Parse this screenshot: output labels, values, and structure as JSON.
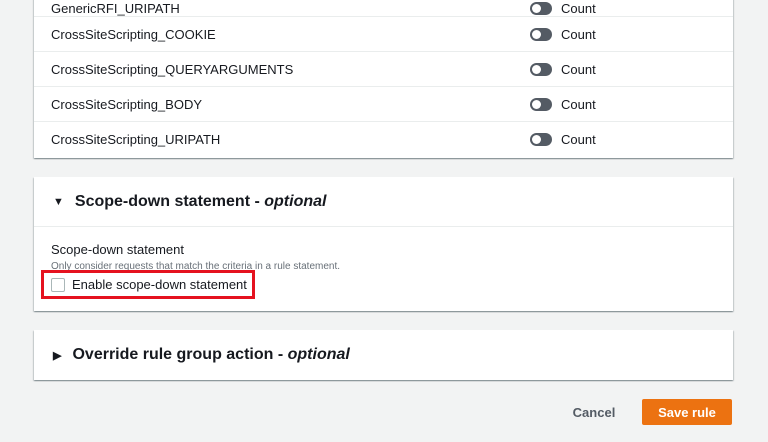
{
  "rules": [
    {
      "name": "GenericRFI_URIPATH",
      "action": "Count"
    },
    {
      "name": "CrossSiteScripting_COOKIE",
      "action": "Count"
    },
    {
      "name": "CrossSiteScripting_QUERYARGUMENTS",
      "action": "Count"
    },
    {
      "name": "CrossSiteScripting_BODY",
      "action": "Count"
    },
    {
      "name": "CrossSiteScripting_URIPATH",
      "action": "Count"
    }
  ],
  "scope": {
    "title": "Scope-down statement",
    "optional": "optional",
    "label": "Scope-down statement",
    "description": "Only consider requests that match the criteria in a rule statement.",
    "checkbox_label": "Enable scope-down statement",
    "checked": false
  },
  "override": {
    "title": "Override rule group action",
    "optional": "optional"
  },
  "actions": {
    "cancel": "Cancel",
    "save": "Save rule"
  },
  "colors": {
    "primary": "#ec7211",
    "highlight": "#e5121f"
  }
}
